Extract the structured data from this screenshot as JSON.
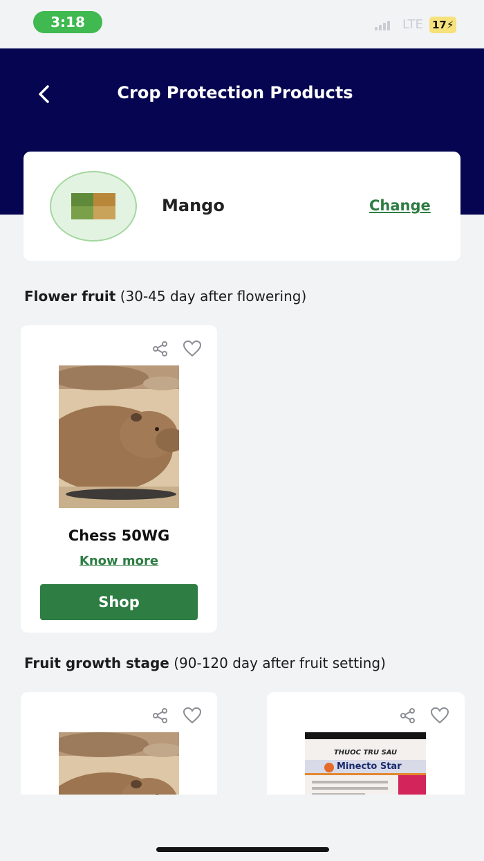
{
  "status_bar": {
    "time": "3:18",
    "network": "LTE",
    "battery": "17"
  },
  "header": {
    "title": "Crop Protection Products"
  },
  "crop": {
    "name": "Mango",
    "change_label": "Change"
  },
  "sections": [
    {
      "title_bold": "Flower fruit",
      "title_rest": " (30-45 day after flowering)",
      "products": [
        {
          "name": "Chess 50WG",
          "know_more": "Know more",
          "shop": "Shop"
        }
      ]
    },
    {
      "title_bold": "Fruit growth stage",
      "title_rest": " (90-120 day after fruit setting)",
      "products": [
        {
          "image": "capybara-photo"
        },
        {
          "image": "minecto-star-package",
          "package_top": "THUOC TRU SAU",
          "package_brand": "Minecto Star"
        }
      ]
    }
  ],
  "icons": {
    "back": "chevron-left-icon",
    "share": "share-icon",
    "favorite": "heart-icon"
  },
  "colors": {
    "header_bg": "#050551",
    "accent_green": "#2e7d43",
    "status_pill": "#3fb950"
  }
}
